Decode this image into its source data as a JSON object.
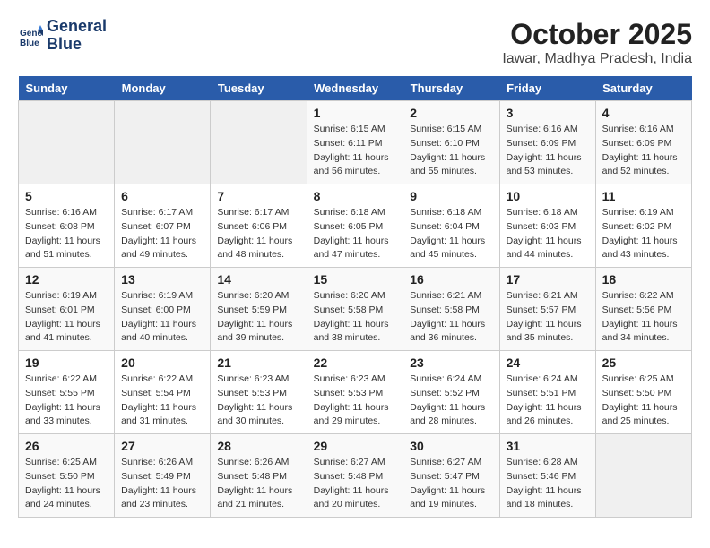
{
  "header": {
    "logo_line1": "General",
    "logo_line2": "Blue",
    "month": "October 2025",
    "location": "Iawar, Madhya Pradesh, India"
  },
  "weekdays": [
    "Sunday",
    "Monday",
    "Tuesday",
    "Wednesday",
    "Thursday",
    "Friday",
    "Saturday"
  ],
  "weeks": [
    [
      {
        "day": "",
        "info": ""
      },
      {
        "day": "",
        "info": ""
      },
      {
        "day": "",
        "info": ""
      },
      {
        "day": "1",
        "info": "Sunrise: 6:15 AM\nSunset: 6:11 PM\nDaylight: 11 hours\nand 56 minutes."
      },
      {
        "day": "2",
        "info": "Sunrise: 6:15 AM\nSunset: 6:10 PM\nDaylight: 11 hours\nand 55 minutes."
      },
      {
        "day": "3",
        "info": "Sunrise: 6:16 AM\nSunset: 6:09 PM\nDaylight: 11 hours\nand 53 minutes."
      },
      {
        "day": "4",
        "info": "Sunrise: 6:16 AM\nSunset: 6:09 PM\nDaylight: 11 hours\nand 52 minutes."
      }
    ],
    [
      {
        "day": "5",
        "info": "Sunrise: 6:16 AM\nSunset: 6:08 PM\nDaylight: 11 hours\nand 51 minutes."
      },
      {
        "day": "6",
        "info": "Sunrise: 6:17 AM\nSunset: 6:07 PM\nDaylight: 11 hours\nand 49 minutes."
      },
      {
        "day": "7",
        "info": "Sunrise: 6:17 AM\nSunset: 6:06 PM\nDaylight: 11 hours\nand 48 minutes."
      },
      {
        "day": "8",
        "info": "Sunrise: 6:18 AM\nSunset: 6:05 PM\nDaylight: 11 hours\nand 47 minutes."
      },
      {
        "day": "9",
        "info": "Sunrise: 6:18 AM\nSunset: 6:04 PM\nDaylight: 11 hours\nand 45 minutes."
      },
      {
        "day": "10",
        "info": "Sunrise: 6:18 AM\nSunset: 6:03 PM\nDaylight: 11 hours\nand 44 minutes."
      },
      {
        "day": "11",
        "info": "Sunrise: 6:19 AM\nSunset: 6:02 PM\nDaylight: 11 hours\nand 43 minutes."
      }
    ],
    [
      {
        "day": "12",
        "info": "Sunrise: 6:19 AM\nSunset: 6:01 PM\nDaylight: 11 hours\nand 41 minutes."
      },
      {
        "day": "13",
        "info": "Sunrise: 6:19 AM\nSunset: 6:00 PM\nDaylight: 11 hours\nand 40 minutes."
      },
      {
        "day": "14",
        "info": "Sunrise: 6:20 AM\nSunset: 5:59 PM\nDaylight: 11 hours\nand 39 minutes."
      },
      {
        "day": "15",
        "info": "Sunrise: 6:20 AM\nSunset: 5:58 PM\nDaylight: 11 hours\nand 38 minutes."
      },
      {
        "day": "16",
        "info": "Sunrise: 6:21 AM\nSunset: 5:58 PM\nDaylight: 11 hours\nand 36 minutes."
      },
      {
        "day": "17",
        "info": "Sunrise: 6:21 AM\nSunset: 5:57 PM\nDaylight: 11 hours\nand 35 minutes."
      },
      {
        "day": "18",
        "info": "Sunrise: 6:22 AM\nSunset: 5:56 PM\nDaylight: 11 hours\nand 34 minutes."
      }
    ],
    [
      {
        "day": "19",
        "info": "Sunrise: 6:22 AM\nSunset: 5:55 PM\nDaylight: 11 hours\nand 33 minutes."
      },
      {
        "day": "20",
        "info": "Sunrise: 6:22 AM\nSunset: 5:54 PM\nDaylight: 11 hours\nand 31 minutes."
      },
      {
        "day": "21",
        "info": "Sunrise: 6:23 AM\nSunset: 5:53 PM\nDaylight: 11 hours\nand 30 minutes."
      },
      {
        "day": "22",
        "info": "Sunrise: 6:23 AM\nSunset: 5:53 PM\nDaylight: 11 hours\nand 29 minutes."
      },
      {
        "day": "23",
        "info": "Sunrise: 6:24 AM\nSunset: 5:52 PM\nDaylight: 11 hours\nand 28 minutes."
      },
      {
        "day": "24",
        "info": "Sunrise: 6:24 AM\nSunset: 5:51 PM\nDaylight: 11 hours\nand 26 minutes."
      },
      {
        "day": "25",
        "info": "Sunrise: 6:25 AM\nSunset: 5:50 PM\nDaylight: 11 hours\nand 25 minutes."
      }
    ],
    [
      {
        "day": "26",
        "info": "Sunrise: 6:25 AM\nSunset: 5:50 PM\nDaylight: 11 hours\nand 24 minutes."
      },
      {
        "day": "27",
        "info": "Sunrise: 6:26 AM\nSunset: 5:49 PM\nDaylight: 11 hours\nand 23 minutes."
      },
      {
        "day": "28",
        "info": "Sunrise: 6:26 AM\nSunset: 5:48 PM\nDaylight: 11 hours\nand 21 minutes."
      },
      {
        "day": "29",
        "info": "Sunrise: 6:27 AM\nSunset: 5:48 PM\nDaylight: 11 hours\nand 20 minutes."
      },
      {
        "day": "30",
        "info": "Sunrise: 6:27 AM\nSunset: 5:47 PM\nDaylight: 11 hours\nand 19 minutes."
      },
      {
        "day": "31",
        "info": "Sunrise: 6:28 AM\nSunset: 5:46 PM\nDaylight: 11 hours\nand 18 minutes."
      },
      {
        "day": "",
        "info": ""
      }
    ]
  ]
}
